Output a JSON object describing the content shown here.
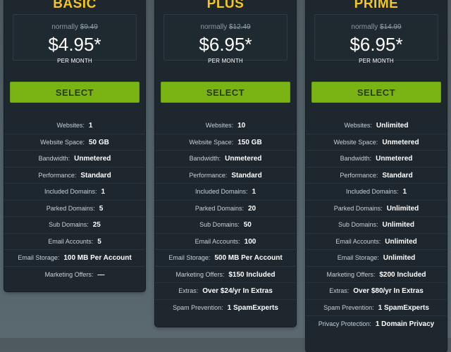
{
  "plans": [
    {
      "name": "BASIC",
      "normally_label": "normally",
      "normal_price": "$9.49",
      "price": "$4.95*",
      "period": "PER MONTH",
      "button_label": "SELECT",
      "features": [
        {
          "label": "Websites:",
          "value": "1"
        },
        {
          "label": "Website Space:",
          "value": "50 GB"
        },
        {
          "label": "Bandwidth:",
          "value": "Unmetered"
        },
        {
          "label": "Performance:",
          "value": "Standard"
        },
        {
          "label": "Included Domains:",
          "value": "1"
        },
        {
          "label": "Parked Domains:",
          "value": "5"
        },
        {
          "label": "Sub Domains:",
          "value": "25"
        },
        {
          "label": "Email Accounts:",
          "value": "5"
        },
        {
          "label": "Email Storage:",
          "value": "100 MB Per Account"
        },
        {
          "label": "Marketing Offers:",
          "value": "—"
        }
      ]
    },
    {
      "name": "PLUS",
      "normally_label": "normally",
      "normal_price": "$12.49",
      "price": "$6.95*",
      "period": "PER MONTH",
      "button_label": "SELECT",
      "features": [
        {
          "label": "Websites:",
          "value": "10"
        },
        {
          "label": "Website Space:",
          "value": "150 GB"
        },
        {
          "label": "Bandwidth:",
          "value": "Unmetered"
        },
        {
          "label": "Performance:",
          "value": "Standard"
        },
        {
          "label": "Included Domains:",
          "value": "1"
        },
        {
          "label": "Parked Domains:",
          "value": "20"
        },
        {
          "label": "Sub Domains:",
          "value": "50"
        },
        {
          "label": "Email Accounts:",
          "value": "100"
        },
        {
          "label": "Email Storage:",
          "value": "500 MB Per Account"
        },
        {
          "label": "Marketing Offers:",
          "value": "$150 Included"
        },
        {
          "label": "Extras:",
          "value": "Over $24/yr In Extras"
        },
        {
          "label": "Spam Prevention:",
          "value": "1 SpamExperts"
        }
      ]
    },
    {
      "name": "PRIME",
      "normally_label": "normally",
      "normal_price": "$14.99",
      "price": "$6.95*",
      "period": "PER MONTH",
      "button_label": "SELECT",
      "features": [
        {
          "label": "Websites:",
          "value": "Unlimited"
        },
        {
          "label": "Website Space:",
          "value": "Unmetered"
        },
        {
          "label": "Bandwidth:",
          "value": "Unmetered"
        },
        {
          "label": "Performance:",
          "value": "Standard"
        },
        {
          "label": "Included Domains:",
          "value": "1"
        },
        {
          "label": "Parked Domains:",
          "value": "Unlimited"
        },
        {
          "label": "Sub Domains:",
          "value": "Unlimited"
        },
        {
          "label": "Email Accounts:",
          "value": "Unlimited"
        },
        {
          "label": "Email Storage:",
          "value": "Unlimited"
        },
        {
          "label": "Marketing Offers:",
          "value": "$200 Included"
        },
        {
          "label": "Extras:",
          "value": "Over $80/yr In Extras"
        },
        {
          "label": "Spam Prevention:",
          "value": "1 SpamExperts"
        },
        {
          "label": "Privacy Protection:",
          "value": "1 Domain Privacy"
        }
      ]
    }
  ],
  "colors": {
    "plan_name": "#f3c623",
    "select_button": "#7ab414",
    "card_background": "#1e272e"
  }
}
